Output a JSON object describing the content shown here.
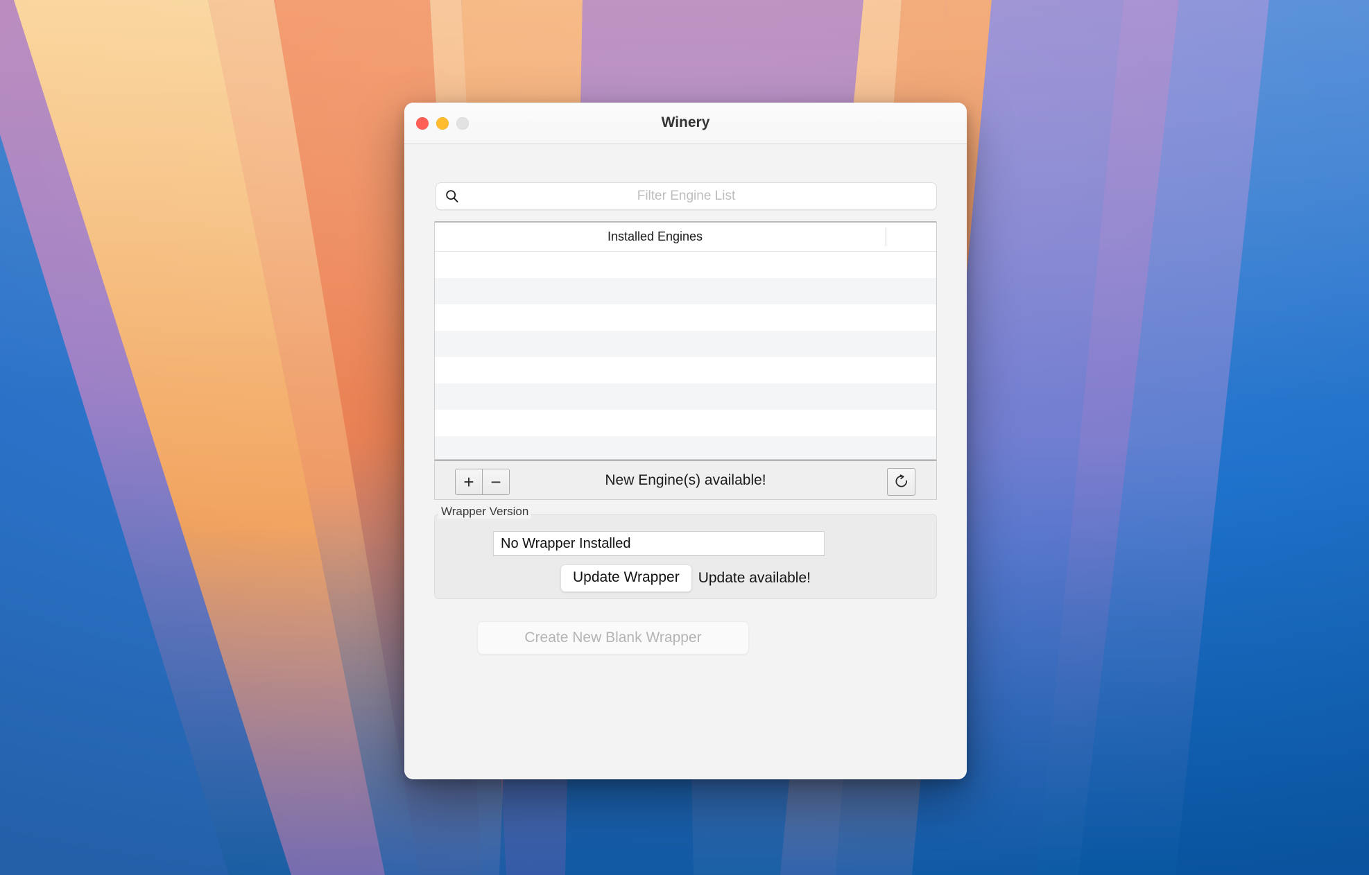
{
  "window": {
    "title": "Winery",
    "traffic_lights": [
      {
        "name": "close",
        "color": "#ff5f57"
      },
      {
        "name": "minimize",
        "color": "#febc2e"
      },
      {
        "name": "zoom",
        "color": "#e2e2e2"
      }
    ]
  },
  "search": {
    "placeholder": "Filter Engine List",
    "value": "",
    "icon": "search-icon"
  },
  "engine_list": {
    "column_header": "Installed Engines",
    "rows": [
      "",
      "",
      "",
      "",
      "",
      "",
      "",
      ""
    ]
  },
  "list_toolbar": {
    "add_label": "+",
    "remove_label": "−",
    "status_text": "New Engine(s) available!",
    "refresh_icon": "refresh-icon"
  },
  "wrapper_section": {
    "group_label": "Wrapper Version",
    "version_value": "No Wrapper Installed",
    "update_button_label": "Update Wrapper",
    "update_status": "Update available!"
  },
  "footer": {
    "create_button_label": "Create New Blank Wrapper",
    "create_button_enabled": false
  }
}
